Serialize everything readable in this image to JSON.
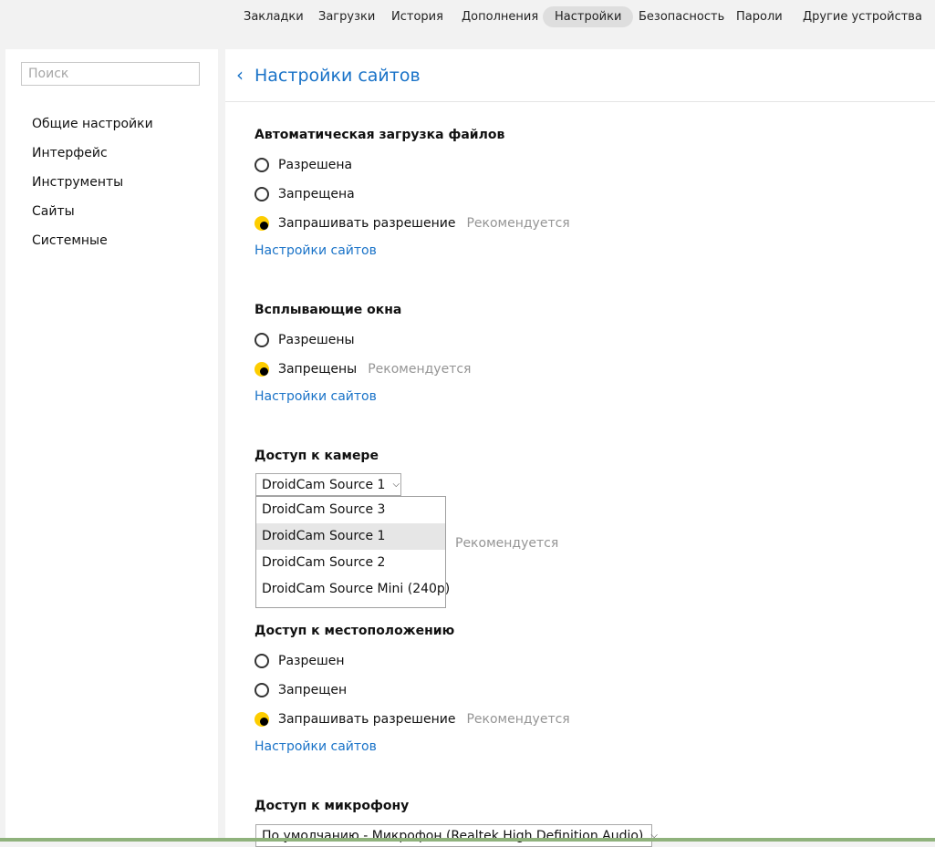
{
  "top_nav": {
    "tabs": [
      "Закладки",
      "Загрузки",
      "История",
      "Дополнения",
      "Настройки",
      "Безопасность",
      "Пароли",
      "Другие устройства"
    ],
    "active": "Настройки"
  },
  "sidebar": {
    "search_placeholder": "Поиск",
    "items": [
      "Общие настройки",
      "Интерфейс",
      "Инструменты",
      "Сайты",
      "Системные"
    ]
  },
  "page": {
    "title": "Настройки сайтов"
  },
  "recommended": "Рекомендуется",
  "site_settings_link": "Настройки сайтов",
  "sections": {
    "downloads": {
      "title": "Автоматическая загрузка файлов",
      "options": [
        "Разрешена",
        "Запрещена",
        "Запрашивать разрешение"
      ],
      "selected": "Запрашивать разрешение"
    },
    "popups": {
      "title": "Всплывающие окна",
      "options": [
        "Разрешены",
        "Запрещены"
      ],
      "selected": "Запрещены"
    },
    "camera": {
      "title": "Доступ к камере",
      "selected": "DroidCam Source 1",
      "options": [
        "DroidCam Source 3",
        "DroidCam Source 1",
        "DroidCam Source 2",
        "DroidCam Source Mini (240p)"
      ]
    },
    "location": {
      "title": "Доступ к местоположению",
      "options": [
        "Разрешен",
        "Запрещен",
        "Запрашивать разрешение"
      ],
      "selected": "Запрашивать разрешение"
    },
    "microphone": {
      "title": "Доступ к микрофону",
      "selected": "По умолчанию - Микрофон (Realtek High Definition Audio)"
    }
  },
  "colors": {
    "accent": "#fdcd00",
    "link": "#1a73c8",
    "muted": "#959595"
  },
  "icons": {
    "back": "chevron-left-icon",
    "dropdown": "chevron-down-icon"
  }
}
